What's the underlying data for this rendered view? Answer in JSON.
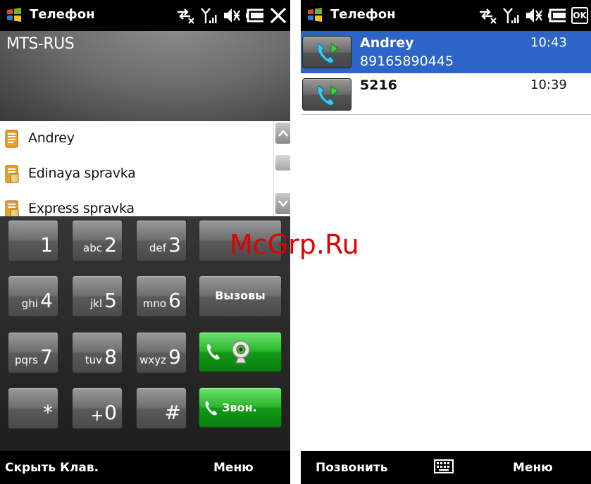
{
  "left": {
    "status": {
      "title": "Телефон"
    },
    "carrier": "MTS-RUS",
    "contacts": [
      {
        "name": "Andrey"
      },
      {
        "name": "Edinaya spravka"
      },
      {
        "name": "Express spravka"
      }
    ],
    "keys": [
      {
        "digit": "1",
        "letters": ""
      },
      {
        "digit": "2",
        "letters": "abc"
      },
      {
        "digit": "3",
        "letters": "def"
      },
      {
        "digit": "4",
        "letters": "ghi"
      },
      {
        "digit": "5",
        "letters": "jkl"
      },
      {
        "digit": "6",
        "letters": "mno"
      },
      {
        "digit": "7",
        "letters": "pqrs"
      },
      {
        "digit": "8",
        "letters": "tuv"
      },
      {
        "digit": "9",
        "letters": "wxyz"
      },
      {
        "digit": "*",
        "letters": ""
      },
      {
        "digit": "0",
        "letters": "+"
      },
      {
        "digit": "#",
        "letters": ""
      }
    ],
    "calls_button": "Вызовы",
    "dial_button": "Звон.",
    "softkeys": {
      "left": "Скрыть Клав.",
      "right": "Меню"
    }
  },
  "right": {
    "status": {
      "title": "Телефон",
      "ok": "OK"
    },
    "calls": [
      {
        "name": "Andrey",
        "time": "10:43",
        "number": "89165890445"
      },
      {
        "name": "5216",
        "time": "10:39",
        "number": ""
      }
    ],
    "softkeys": {
      "left": "Позвонить",
      "right": "Меню",
      "keyboard": "keyboard-icon"
    }
  },
  "watermark": "McGrp.Ru",
  "colors": {
    "selection": "#2c64c8",
    "call_green": "#1fa823",
    "watermark": "#e00000"
  }
}
